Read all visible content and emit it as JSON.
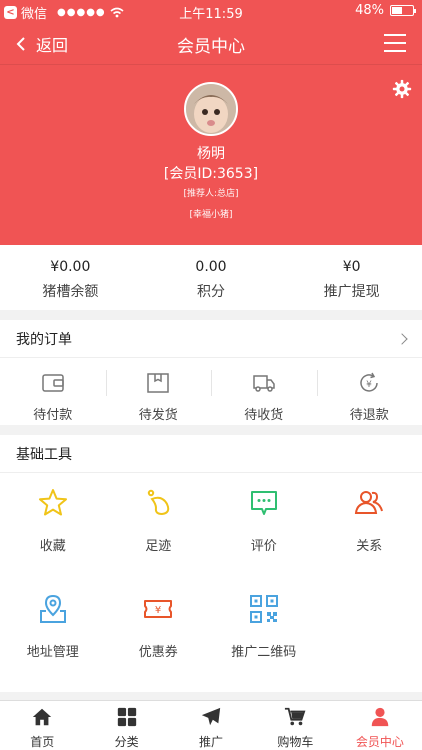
{
  "status_bar": {
    "app_name": "微信",
    "signal": "●●●●●",
    "time": "上午11:59",
    "battery_text": "48%",
    "battery_level": 0.48
  },
  "nav": {
    "back_label": "返回",
    "title": "会员中心"
  },
  "profile": {
    "name": "杨明",
    "member_id": "[会员ID:3653]",
    "referrer": "[推荐人:总店]",
    "tag": "[幸福小猪]"
  },
  "stats": [
    {
      "value": "¥0.00",
      "label": "猪槽余额"
    },
    {
      "value": "0.00",
      "label": "积分"
    },
    {
      "value": "¥0",
      "label": "推广提现"
    }
  ],
  "orders": {
    "title": "我的订单",
    "items": [
      {
        "label": "待付款",
        "icon": "wallet-icon"
      },
      {
        "label": "待发货",
        "icon": "box-icon"
      },
      {
        "label": "待收货",
        "icon": "truck-icon"
      },
      {
        "label": "待退款",
        "icon": "refund-icon"
      }
    ]
  },
  "tools": {
    "title": "基础工具",
    "items": [
      {
        "label": "收藏",
        "icon": "star-icon"
      },
      {
        "label": "足迹",
        "icon": "footprint-icon"
      },
      {
        "label": "评价",
        "icon": "comment-icon"
      },
      {
        "label": "关系",
        "icon": "relation-icon"
      },
      {
        "label": "地址管理",
        "icon": "map-pin-icon"
      },
      {
        "label": "优惠券",
        "icon": "coupon-icon"
      },
      {
        "label": "推广二维码",
        "icon": "qrcode-icon"
      }
    ]
  },
  "tabbar": [
    {
      "label": "首页",
      "icon": "home-icon"
    },
    {
      "label": "分类",
      "icon": "grid-icon"
    },
    {
      "label": "推广",
      "icon": "send-icon"
    },
    {
      "label": "购物车",
      "icon": "cart-icon"
    },
    {
      "label": "会员中心",
      "icon": "user-icon",
      "active": true
    }
  ],
  "colors": {
    "brand": "#f05454",
    "star": "#f0c419",
    "footprint": "#f0c419",
    "comment": "#2fbf71",
    "relation": "#e8552a",
    "map_pin": "#4aa3df",
    "coupon": "#e8552a",
    "qrcode": "#4aa3df"
  }
}
